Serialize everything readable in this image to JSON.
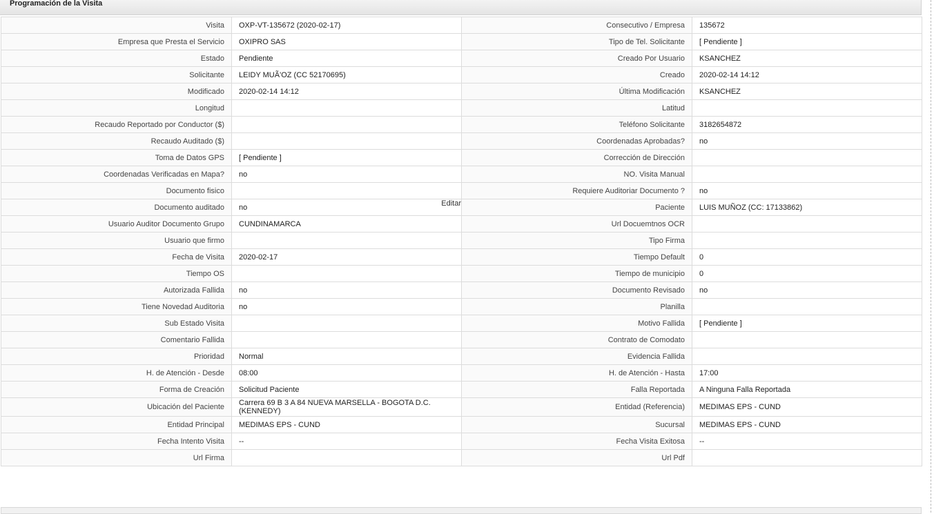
{
  "panel": {
    "title": "Programación de la Visita"
  },
  "rows": [
    {
      "l1": "Visita",
      "v1": "OXP-VT-135672 (2020-02-17)",
      "l2": "Consecutivo / Empresa",
      "v2": "135672"
    },
    {
      "l1": "Empresa que Presta el Servicio",
      "v1": "OXIPRO SAS",
      "l2": "Tipo de Tel. Solicitante",
      "v2": "[ Pendiente ]"
    },
    {
      "l1": "Estado",
      "v1": "Pendiente",
      "l2": "Creado Por Usuario",
      "v2": "KSANCHEZ"
    },
    {
      "l1": "Solicitante",
      "v1": "LEIDY MUÃ'OZ (CC 52170695)",
      "l2": "Creado",
      "v2": "2020-02-14 14:12"
    },
    {
      "l1": "Modificado",
      "v1": "2020-02-14 14:12",
      "l2": "Última Modificación",
      "v2": " KSANCHEZ"
    },
    {
      "l1": "Longitud",
      "v1": "",
      "l2": "Latitud",
      "v2": ""
    },
    {
      "l1": "Recaudo Reportado por Conductor ($)",
      "v1": "",
      "l2": "Teléfono Solicitante",
      "v2": "3182654872"
    },
    {
      "l1": "Recaudo Auditado ($)",
      "v1": "",
      "l2": "Coordenadas Aprobadas?",
      "v2": " no"
    },
    {
      "l1": "Toma de Datos GPS",
      "v1": "[ Pendiente ]",
      "l2": "Corrección de Dirección",
      "v2": ""
    },
    {
      "l1": "Coordenadas Verificadas en Mapa?",
      "v1": " no",
      "l2": "NO. Visita Manual",
      "v2": ""
    },
    {
      "l1": "Documento fisico",
      "v1": "",
      "l2": "Requiere Auditoriar Documento ?",
      "v2": " no"
    },
    {
      "l1": "Documento auditado",
      "v1": " no",
      "l2": "Paciente",
      "v2": "LUIS MUÑOZ (CC: 17133862)",
      "edit": "Editar"
    },
    {
      "l1": "Usuario Auditor Documento Grupo",
      "v1": "CUNDINAMARCA",
      "l2": "Url Docuemtnos OCR",
      "v2": ""
    },
    {
      "l1": "Usuario que firmo",
      "v1": "",
      "l2": "Tipo Firma",
      "v2": ""
    },
    {
      "l1": "Fecha de Visita",
      "v1": " 2020-02-17",
      "l2": "Tiempo Default",
      "v2": "0"
    },
    {
      "l1": "Tiempo OS",
      "v1": "",
      "l2": "Tiempo de municipio",
      "v2": "0"
    },
    {
      "l1": "Autorizada Fallida",
      "v1": " no",
      "l2": "Documento Revisado",
      "v2": " no"
    },
    {
      "l1": "Tiene Novedad Auditoria",
      "v1": " no",
      "l2": "Planilla",
      "v2": ""
    },
    {
      "l1": "Sub Estado Visita",
      "v1": "",
      "l2": "Motivo Fallida",
      "v2": "[ Pendiente ]"
    },
    {
      "l1": "Comentario Fallida",
      "v1": "",
      "l2": "Contrato de Comodato",
      "v2": ""
    },
    {
      "l1": "Prioridad",
      "v1": "Normal",
      "l2": "Evidencia Fallida",
      "v2": ""
    },
    {
      "l1": "H. de Atención - Desde",
      "v1": "08:00",
      "l2": "H. de Atención - Hasta",
      "v2": "17:00"
    },
    {
      "l1": "Forma de Creación",
      "v1": "Solicitud Paciente",
      "l2": "Falla Reportada",
      "v2": "A Ninguna Falla Reportada"
    },
    {
      "l1": "Ubicación del Paciente",
      "v1": "Carrera 69 B 3 A 84 NUEVA MARSELLA - BOGOTA D.C. (KENNEDY)",
      "l2": "Entidad (Referencia)",
      "v2": "MEDIMAS EPS - CUND",
      "tall": true
    },
    {
      "l1": "Entidad Principal",
      "v1": "MEDIMAS EPS - CUND",
      "l2": "Sucursal",
      "v2": "MEDIMAS EPS - CUND"
    },
    {
      "l1": "Fecha Intento Visita",
      "v1": " --",
      "l2": "Fecha Visita Exitosa",
      "v2": " --"
    },
    {
      "l1": "Url Firma",
      "v1": "",
      "l2": "Url Pdf",
      "v2": ""
    }
  ]
}
